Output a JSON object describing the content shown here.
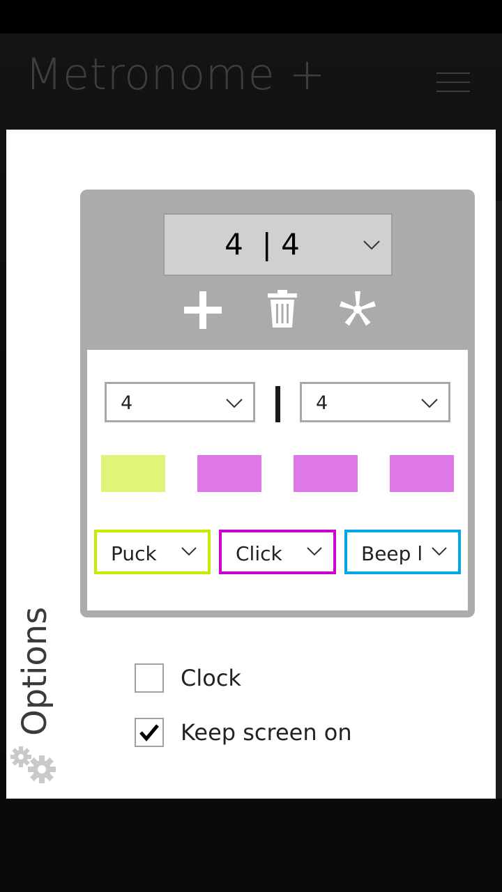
{
  "app": {
    "title": "Metronome +"
  },
  "time_signature": {
    "value": "4  | 4"
  },
  "toolbar": {
    "add": "plus-icon",
    "delete": "trash-icon",
    "reset": "asterisk-icon"
  },
  "measure": {
    "beats": "4",
    "note_value": "4"
  },
  "beats": [
    {
      "color": "#dff577"
    },
    {
      "color": "#e077e6"
    },
    {
      "color": "#e077e6"
    },
    {
      "color": "#e077e6"
    }
  ],
  "sounds": [
    {
      "label": "Puck",
      "color": "#c8ea00"
    },
    {
      "label": "Click",
      "color": "#c800d0"
    },
    {
      "label": "Beep l",
      "color": "#00a8e8"
    }
  ],
  "options": {
    "title": "Options",
    "clock": {
      "label": "Clock",
      "checked": false
    },
    "keep_screen_on": {
      "label": "Keep screen on",
      "checked": true
    }
  }
}
